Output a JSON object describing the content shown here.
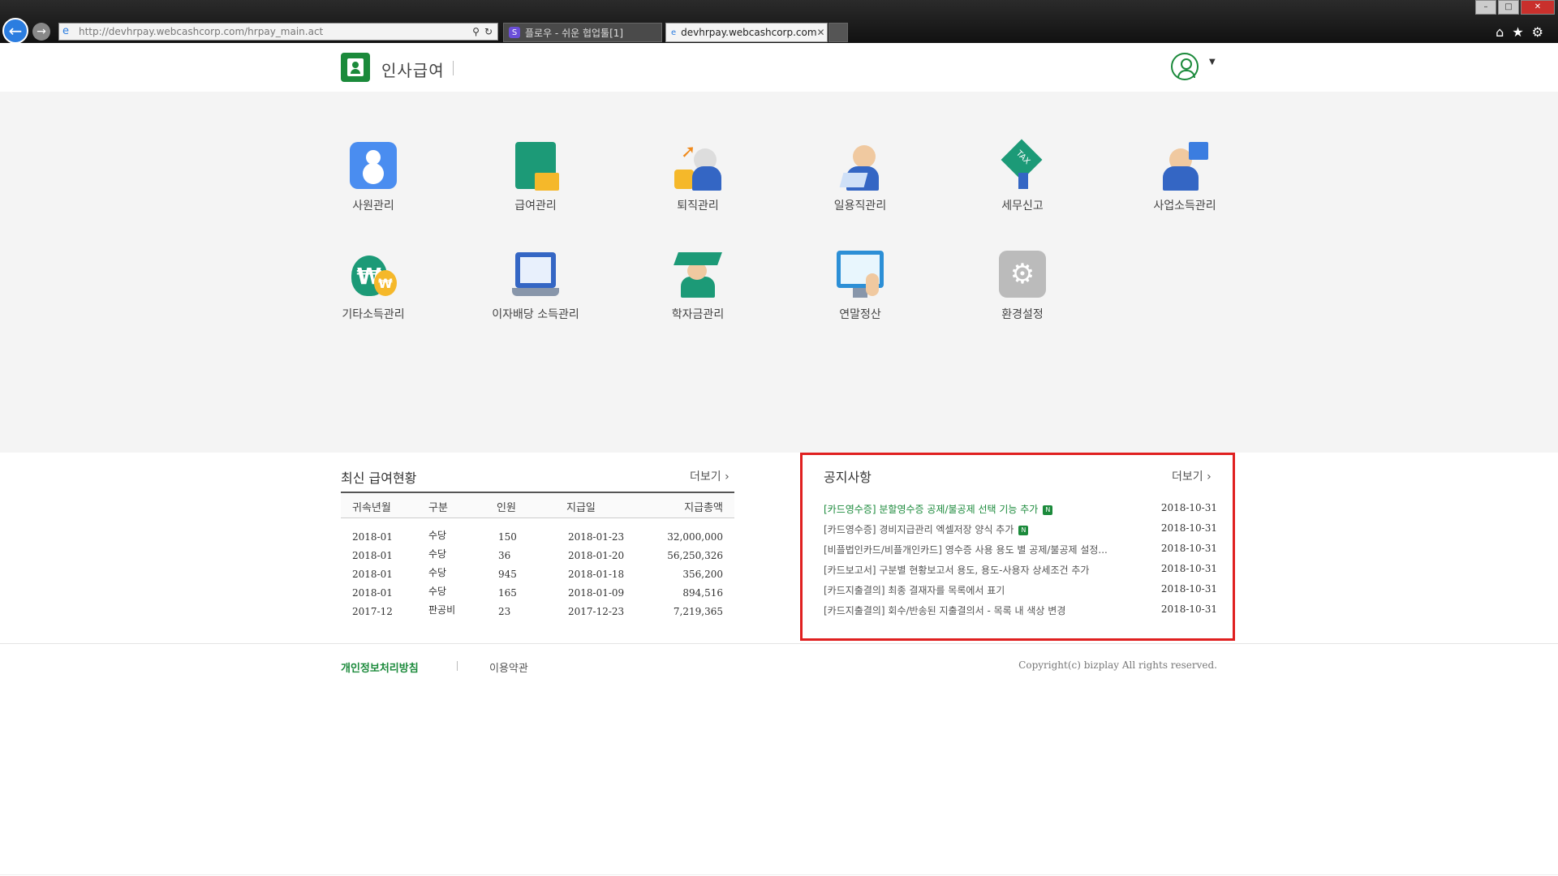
{
  "browser": {
    "url": "http://devhrpay.webcashcorp.com/hrpay_main.act",
    "tabs": [
      {
        "label": "플로우 - 쉬운 협업툴[1]",
        "active": false
      },
      {
        "label": "devhrpay.webcashcorp.com",
        "active": true
      }
    ]
  },
  "header": {
    "app_title": "인사급여"
  },
  "menu": {
    "items": [
      {
        "label": "사원관리",
        "icon": "employee-icon"
      },
      {
        "label": "급여관리",
        "icon": "payroll-book-icon"
      },
      {
        "label": "퇴직관리",
        "icon": "retirement-icon"
      },
      {
        "label": "일용직관리",
        "icon": "daily-worker-icon"
      },
      {
        "label": "세무신고",
        "icon": "tax-tag-icon"
      },
      {
        "label": "사업소득관리",
        "icon": "business-income-icon"
      },
      {
        "label": "기타소득관리",
        "icon": "money-bag-icon"
      },
      {
        "label": "이자배당 소득관리",
        "icon": "laptop-chart-icon"
      },
      {
        "label": "학자금관리",
        "icon": "graduate-icon"
      },
      {
        "label": "연말정산",
        "icon": "monitor-chart-icon"
      },
      {
        "label": "환경설정",
        "icon": "gear-icon"
      }
    ]
  },
  "salary": {
    "title": "최신 급여현황",
    "more": "더보기",
    "columns": [
      "귀속년월",
      "구분",
      "인원",
      "지급일",
      "지급총액"
    ],
    "rows": [
      [
        "2018-01",
        "수당",
        "150",
        "2018-01-23",
        "32,000,000"
      ],
      [
        "2018-01",
        "수당",
        "36",
        "2018-01-20",
        "56,250,326"
      ],
      [
        "2018-01",
        "수당",
        "945",
        "2018-01-18",
        "356,200"
      ],
      [
        "2018-01",
        "수당",
        "165",
        "2018-01-09",
        "894,516"
      ],
      [
        "2017-12",
        "판공비",
        "23",
        "2017-12-23",
        "7,219,365"
      ]
    ]
  },
  "notice": {
    "title": "공지사항",
    "more": "더보기",
    "items": [
      {
        "text": "[카드영수증] 분할영수증 공제/불공제 선택 기능 추가",
        "date": "2018-10-31",
        "new": true,
        "highlight": true
      },
      {
        "text": "[카드영수증] 경비지급관리 엑셀저장 양식 추가",
        "date": "2018-10-31",
        "new": true,
        "highlight": false
      },
      {
        "text": "[비플법인카드/비플개인카드] 영수증 사용 용도 별 공제/불공제 설정...",
        "date": "2018-10-31",
        "new": false,
        "highlight": false
      },
      {
        "text": "[카드보고서] 구분별 현황보고서 용도, 용도-사용자 상세조건 추가",
        "date": "2018-10-31",
        "new": false,
        "highlight": false
      },
      {
        "text": "[카드지출결의] 최종 결재자를 목록에서 표기",
        "date": "2018-10-31",
        "new": false,
        "highlight": false
      },
      {
        "text": "[카드지출결의] 회수/반송된 지출결의서 - 목록 내 색상 변경",
        "date": "2018-10-31",
        "new": false,
        "highlight": false
      }
    ],
    "new_badge": "N"
  },
  "footer": {
    "privacy": "개인정보처리방침",
    "terms": "이용약관",
    "copyright": "Copyright(c) bizplay All rights reserved."
  },
  "colors": {
    "brand_green": "#1b8a3b",
    "highlight_red": "#e02020"
  }
}
